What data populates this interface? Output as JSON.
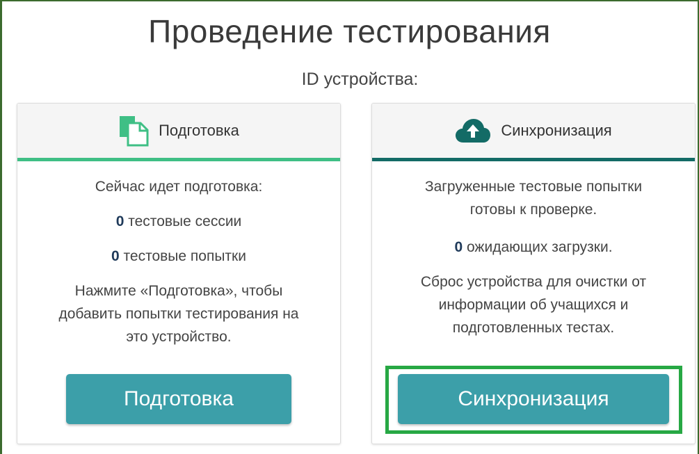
{
  "page": {
    "title": "Проведение тестирования",
    "device_id_label": "ID устройства:"
  },
  "prepare_card": {
    "header": "Подготовка",
    "icon": "document-copy-icon",
    "accent_color": "#3fbf85",
    "status_line": "Сейчас идет подготовка:",
    "sessions_count": "0",
    "sessions_label": "тестовые сессии",
    "attempts_count": "0",
    "attempts_label": "тестовые попытки",
    "instruction_line1": "Нажмите «Подготовка», чтобы",
    "instruction_line2": "добавить попытки тестирования на",
    "instruction_line3": "это устройство.",
    "button_label": "Подготовка"
  },
  "sync_card": {
    "header": "Синхронизация",
    "icon": "cloud-upload-icon",
    "accent_color": "#136b66",
    "uploaded_line1": "Загруженные тестовые попытки",
    "uploaded_line2": "готовы к проверке.",
    "pending_count": "0",
    "pending_label": "ожидающих загрузки.",
    "reset_line1": "Сброс устройства для очистки от",
    "reset_line2": "информации об учащихся и",
    "reset_line3": "подготовленных тестах.",
    "button_label": "Синхронизация"
  },
  "colors": {
    "button": "#3c9fa9",
    "highlight": "#27a844",
    "count": "#1f3a5a"
  }
}
